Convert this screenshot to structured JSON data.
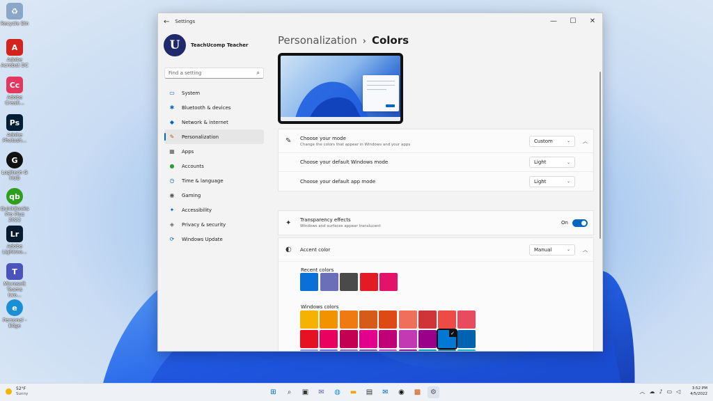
{
  "desktop": {
    "icons": [
      {
        "name": "recycle-bin",
        "label": "Recycle Bin",
        "color": "#8aa7c8",
        "glyph": "♻"
      },
      {
        "name": "adobe-acrobat",
        "label": "Adobe Acrobat DC",
        "color": "#d4221c",
        "glyph": "A"
      },
      {
        "name": "adobe-creative-cloud",
        "label": "Adobe Creati...",
        "color": "#e2385f",
        "glyph": "Cc"
      },
      {
        "name": "adobe-photoshop",
        "label": "Adobe Photosh...",
        "color": "#001e36",
        "glyph": "Ps"
      },
      {
        "name": "logitech-g-hub",
        "label": "Logitech G HUB",
        "color": "#111111",
        "glyph": "G"
      },
      {
        "name": "quickbooks",
        "label": "QuickBooks Pro Plus 2022",
        "color": "#2ca01c",
        "glyph": "qb"
      },
      {
        "name": "adobe-lightroom",
        "label": "Adobe Lightroo...",
        "color": "#0a1a2f",
        "glyph": "Lr"
      },
      {
        "name": "microsoft-teams",
        "label": "Microsoft Teams (wo...",
        "color": "#4b53bc",
        "glyph": "T"
      },
      {
        "name": "microsoft-edge",
        "label": "Personal - Edge",
        "color": "#1b8fd6",
        "glyph": "e"
      }
    ]
  },
  "window": {
    "title": "Settings",
    "profile_name": "TeachUcomp Teacher",
    "avatar_letter": "U",
    "search_placeholder": "Find a setting",
    "nav": [
      {
        "label": "System",
        "icon": "monitor-icon",
        "glyph": "▭",
        "active": false
      },
      {
        "label": "Bluetooth & devices",
        "icon": "bluetooth-icon",
        "glyph": "✱",
        "active": false
      },
      {
        "label": "Network & internet",
        "icon": "wifi-icon",
        "glyph": "◆",
        "active": false
      },
      {
        "label": "Personalization",
        "icon": "brush-icon",
        "glyph": "✎",
        "active": true
      },
      {
        "label": "Apps",
        "icon": "apps-icon",
        "glyph": "▦",
        "active": false
      },
      {
        "label": "Accounts",
        "icon": "person-icon",
        "glyph": "●",
        "active": false
      },
      {
        "label": "Time & language",
        "icon": "clock-globe-icon",
        "glyph": "◷",
        "active": false
      },
      {
        "label": "Gaming",
        "icon": "gamepad-icon",
        "glyph": "◉",
        "active": false
      },
      {
        "label": "Accessibility",
        "icon": "accessibility-icon",
        "glyph": "✦",
        "active": false
      },
      {
        "label": "Privacy & security",
        "icon": "shield-icon",
        "glyph": "◈",
        "active": false
      },
      {
        "label": "Windows Update",
        "icon": "update-icon",
        "glyph": "⟳",
        "active": false
      }
    ],
    "breadcrumb": {
      "parent": "Personalization",
      "current": "Colors"
    },
    "mode": {
      "title": "Choose your mode",
      "desc": "Change the colors that appear in Windows and your apps",
      "value": "Custom"
    },
    "windows_mode": {
      "title": "Choose your default Windows mode",
      "value": "Light"
    },
    "app_mode": {
      "title": "Choose your default app mode",
      "value": "Light"
    },
    "transparency": {
      "title": "Transparency effects",
      "desc": "Windows and surfaces appear translucent",
      "state": "On"
    },
    "accent": {
      "title": "Accent color",
      "value": "Manual"
    },
    "recent_colors_label": "Recent colors",
    "recent_colors": [
      "#0a6fd6",
      "#6a6fb8",
      "#4a4a4a",
      "#e31b23",
      "#e3136a"
    ],
    "windows_colors_label": "Windows colors",
    "windows_colors": [
      [
        "#f5b300",
        "#f39200",
        "#ef7a12",
        "#d65a1a",
        "#dd4a14",
        "#ef6f5a",
        "#d13438",
        "#ee4b44",
        "#e84a5f"
      ],
      [
        "#e81123",
        "#ea005e",
        "#c30052",
        "#e3008c",
        "#bf0077",
        "#c239b3",
        "#9a0089",
        "#0078d4",
        "#0063b1"
      ],
      [
        "#8e8cd8",
        "#6b69d6",
        "#8764b8",
        "#744da9",
        "#b146c2",
        "#881798",
        "#0099bc",
        "#2d7d9a",
        "#00b7c3"
      ]
    ],
    "selected_color": "#0078d4"
  },
  "taskbar": {
    "weather_temp": "52°F",
    "weather_desc": "Sunny",
    "time": "3:52 PM",
    "date": "4/5/2022"
  }
}
